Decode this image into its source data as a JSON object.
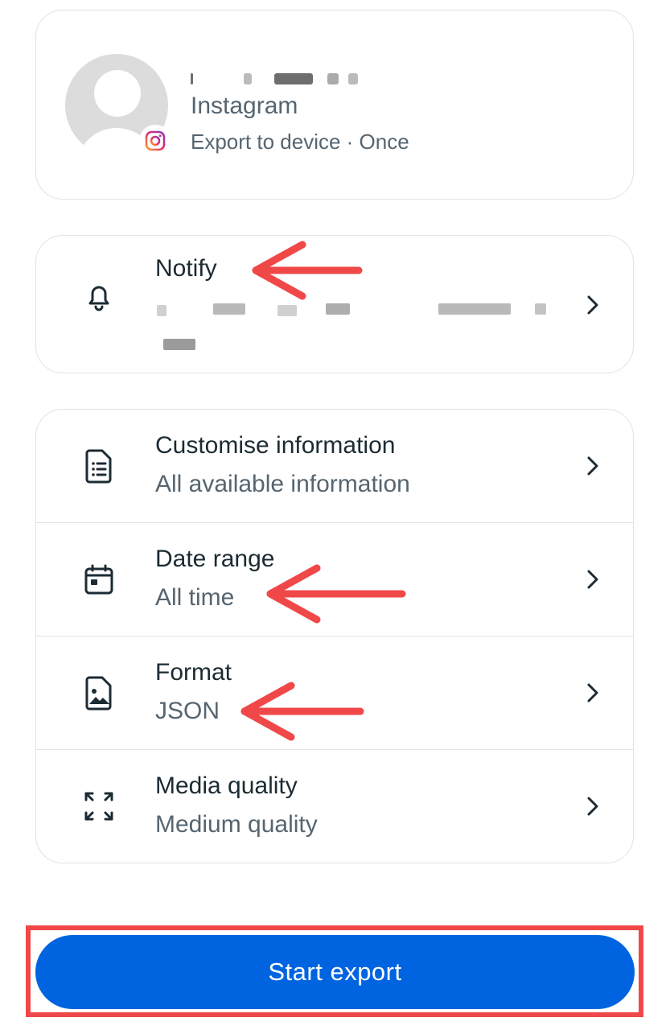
{
  "account": {
    "app_name": "Instagram",
    "export_detail": "Export to device · Once"
  },
  "notify": {
    "title": "Notify"
  },
  "settings": [
    {
      "id": "customise",
      "title": "Customise information",
      "value": "All available information",
      "icon": "document-list-icon"
    },
    {
      "id": "date-range",
      "title": "Date range",
      "value": "All time",
      "icon": "calendar-icon"
    },
    {
      "id": "format",
      "title": "Format",
      "value": "JSON",
      "icon": "image-file-icon"
    },
    {
      "id": "media-quality",
      "title": "Media quality",
      "value": "Medium quality",
      "icon": "expand-arrows-icon"
    }
  ],
  "actions": {
    "start_export_label": "Start export"
  },
  "colors": {
    "primary": "#0064e0",
    "annotation": "#f04848",
    "text_primary": "#1c2b33",
    "text_secondary": "#566570"
  }
}
